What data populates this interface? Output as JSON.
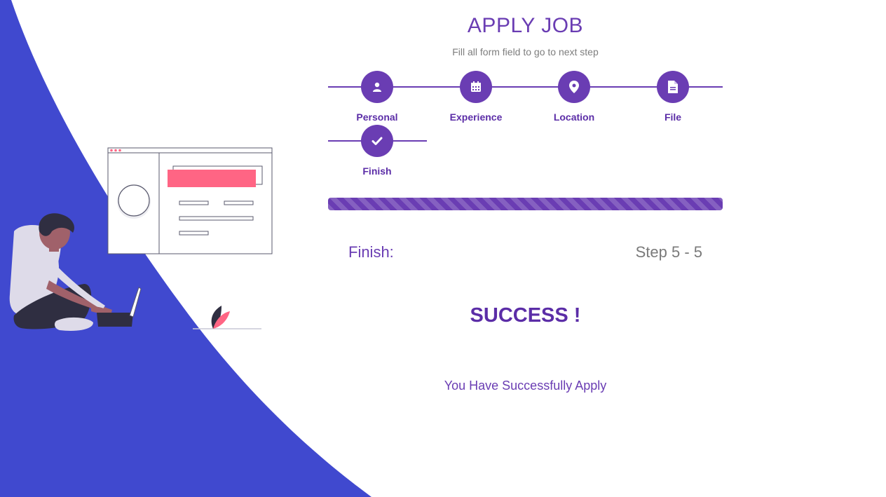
{
  "header": {
    "title": "APPLY JOB",
    "subtitle": "Fill all form field to go to next step"
  },
  "steps": [
    {
      "label": "Personal",
      "icon": "user-icon"
    },
    {
      "label": "Experience",
      "icon": "calendar-icon"
    },
    {
      "label": "Location",
      "icon": "map-pin-icon"
    },
    {
      "label": "File",
      "icon": "file-icon"
    },
    {
      "label": "Finish",
      "icon": "check-icon"
    }
  ],
  "progress": {
    "percent": 100
  },
  "status": {
    "section_label": "Finish:",
    "step_count": "Step 5 - 5"
  },
  "result": {
    "heading": "SUCCESS !",
    "message": "You Have Successfully Apply"
  },
  "colors": {
    "accent": "#6a3db3",
    "background_blob": "#4049cf",
    "illustration_pink": "#ff6584"
  }
}
